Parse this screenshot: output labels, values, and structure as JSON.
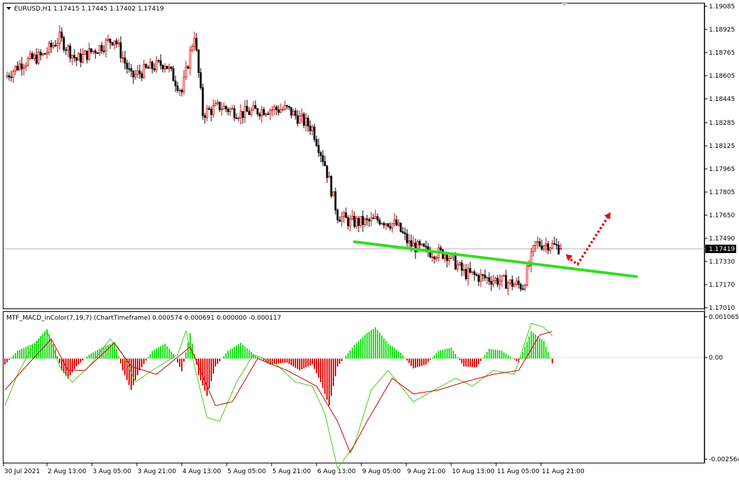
{
  "price_panel": {
    "header": "EURUSD,H1  1.17415 1.17445 1.17402 1.17419",
    "ticks": [
      "1.19085",
      "1.18925",
      "1.18765",
      "1.18605",
      "1.18445",
      "1.18285",
      "1.18125",
      "1.17965",
      "1.17805",
      "1.17650",
      "1.17490",
      "1.17330",
      "1.17170",
      "1.17010"
    ],
    "current_price_label": "1.17419"
  },
  "macd_panel": {
    "header": "MTF_MACD_inColor(7,19,7) (ChartTimeframe) 0.000574 0.000691 0.000000 -0.000117",
    "ticks": [
      "0.001065",
      "0.00",
      "-0.002564"
    ]
  },
  "time_axis": {
    "labels": [
      "30 Jul 2021",
      "2 Aug 13:00",
      "3 Aug 05:00",
      "3 Aug 21:00",
      "4 Aug 13:00",
      "5 Aug 05:00",
      "5 Aug 21:00",
      "6 Aug 13:00",
      "9 Aug 05:00",
      "9 Aug 21:00",
      "10 Aug 13:00",
      "11 Aug 05:00",
      "11 Aug 21:00"
    ]
  },
  "colors": {
    "bull_candle": "#d00000",
    "bear_candle": "#000000",
    "trendline": "#33dd22",
    "projection_arrow": "#e01010",
    "hist_positive": "#22dd22",
    "hist_negative": "#e01010",
    "macd_line": "#44cc11",
    "signal_line": "#cc0000",
    "grid_price_line": "#aaaaaa"
  },
  "chart_data": [
    {
      "type": "candlestick",
      "symbol": "EURUSD",
      "timeframe": "H1",
      "ylim": [
        1.1701,
        1.1909
      ],
      "last": {
        "open": 1.17415,
        "high": 1.17445,
        "low": 1.17402,
        "close": 1.17419
      },
      "path_close_by_bar": [
        [
          0,
          1.186
        ],
        [
          8,
          1.187
        ],
        [
          18,
          1.1875
        ],
        [
          26,
          1.1887
        ],
        [
          34,
          1.1872
        ],
        [
          44,
          1.188
        ],
        [
          52,
          1.1887
        ],
        [
          60,
          1.186
        ],
        [
          68,
          1.1866
        ],
        [
          76,
          1.187
        ],
        [
          84,
          1.185
        ],
        [
          90,
          1.189
        ],
        [
          94,
          1.1835
        ],
        [
          102,
          1.184
        ],
        [
          112,
          1.1835
        ],
        [
          124,
          1.1838
        ],
        [
          134,
          1.1838
        ],
        [
          146,
          1.1825
        ],
        [
          152,
          1.18
        ],
        [
          158,
          1.1765
        ],
        [
          164,
          1.176
        ],
        [
          172,
          1.176
        ],
        [
          178,
          1.1762
        ],
        [
          186,
          1.1758
        ],
        [
          192,
          1.1745
        ],
        [
          200,
          1.174
        ],
        [
          210,
          1.1738
        ],
        [
          218,
          1.1725
        ],
        [
          226,
          1.1722
        ],
        [
          234,
          1.172
        ],
        [
          240,
          1.1718
        ],
        [
          246,
          1.1716
        ],
        [
          252,
          1.1745
        ],
        [
          258,
          1.1745
        ],
        [
          264,
          1.17419
        ]
      ],
      "annotations": [
        {
          "type": "trendline",
          "from": {
            "bar": 166,
            "price": 1.17465
          },
          "to": {
            "bar": 300,
            "price": 1.17225
          }
        },
        {
          "type": "projection_arrow",
          "points": [
            {
              "bar": 267,
              "price": 1.1736
            },
            {
              "bar": 272,
              "price": 1.1731
            },
            {
              "bar": 287,
              "price": 1.1765
            }
          ]
        }
      ]
    },
    {
      "type": "macd_histogram",
      "name": "MTF_MACD_inColor(7,19,7)",
      "ylim": [
        -0.002564,
        0.001065
      ],
      "values_at_last_bar": {
        "macd": 0.000574,
        "signal": 0.000691,
        "hist": -0.000117
      },
      "histogram_by_bar": [
        [
          0,
          -0.00015
        ],
        [
          6,
          0.0002
        ],
        [
          14,
          0.0004
        ],
        [
          20,
          0.00075
        ],
        [
          24,
          0.00025
        ],
        [
          27,
          -0.0003
        ],
        [
          30,
          -0.0005
        ],
        [
          34,
          -0.0002
        ],
        [
          40,
          0.0001
        ],
        [
          46,
          0.00028
        ],
        [
          52,
          0.00042
        ],
        [
          56,
          -0.0003
        ],
        [
          60,
          -0.0008
        ],
        [
          64,
          -0.0003
        ],
        [
          70,
          0.0002
        ],
        [
          76,
          0.00038
        ],
        [
          80,
          0.00012
        ],
        [
          84,
          -0.00032
        ],
        [
          88,
          0.00065
        ],
        [
          92,
          -0.00042
        ],
        [
          96,
          -0.00095
        ],
        [
          100,
          -0.0002
        ],
        [
          106,
          0.0002
        ],
        [
          112,
          0.0004
        ],
        [
          118,
          0.00012
        ],
        [
          126,
          -0.00015
        ],
        [
          134,
          -0.0001
        ],
        [
          140,
          -0.0003
        ],
        [
          146,
          -0.00015
        ],
        [
          150,
          -0.0006
        ],
        [
          154,
          -0.0012
        ],
        [
          158,
          -0.0002
        ],
        [
          166,
          0.00035
        ],
        [
          172,
          0.00065
        ],
        [
          176,
          0.0008
        ],
        [
          182,
          0.00038
        ],
        [
          188,
          0.00015
        ],
        [
          194,
          -0.00025
        ],
        [
          200,
          -0.00015
        ],
        [
          206,
          0.0002
        ],
        [
          212,
          0.00028
        ],
        [
          218,
          -0.0002
        ],
        [
          224,
          -0.00022
        ],
        [
          230,
          0.00025
        ],
        [
          236,
          0.0002
        ],
        [
          244,
          -0.0001
        ],
        [
          250,
          0.0007
        ],
        [
          256,
          0.00045
        ],
        [
          260,
          -0.000117
        ]
      ],
      "macd_by_bar": [
        [
          0,
          -0.0012
        ],
        [
          6,
          -0.0004
        ],
        [
          12,
          0.0002
        ],
        [
          20,
          0.0007
        ],
        [
          26,
          -0.0002
        ],
        [
          32,
          -0.0006
        ],
        [
          40,
          -0.0002
        ],
        [
          50,
          0.0005
        ],
        [
          56,
          0.0001
        ],
        [
          62,
          -0.0006
        ],
        [
          70,
          -0.0003
        ],
        [
          82,
          0.0001
        ],
        [
          86,
          0.0007
        ],
        [
          96,
          -0.0015
        ],
        [
          102,
          -0.0016
        ],
        [
          110,
          -0.0006
        ],
        [
          118,
          0.0001
        ],
        [
          128,
          -0.0001
        ],
        [
          138,
          -0.0006
        ],
        [
          146,
          -0.0007
        ],
        [
          152,
          -0.0014
        ],
        [
          158,
          -0.0028
        ],
        [
          166,
          -0.0022
        ],
        [
          174,
          -0.0008
        ],
        [
          182,
          -0.0003
        ],
        [
          194,
          -0.0011
        ],
        [
          204,
          -0.0008
        ],
        [
          214,
          -0.0005
        ],
        [
          222,
          -0.0007
        ],
        [
          232,
          -0.0003
        ],
        [
          242,
          -0.0004
        ],
        [
          250,
          0.0009
        ],
        [
          256,
          0.0008
        ],
        [
          260,
          0.000574
        ]
      ],
      "signal_by_bar": [
        [
          0,
          -0.0008
        ],
        [
          10,
          -0.0002
        ],
        [
          22,
          0.0005
        ],
        [
          30,
          -0.0003
        ],
        [
          38,
          -0.0003
        ],
        [
          52,
          0.0004
        ],
        [
          60,
          -0.0002
        ],
        [
          72,
          -0.0004
        ],
        [
          88,
          0.0003
        ],
        [
          100,
          -0.0012
        ],
        [
          108,
          -0.0011
        ],
        [
          120,
          0.0
        ],
        [
          134,
          -0.0003
        ],
        [
          148,
          -0.0007
        ],
        [
          158,
          -0.0016
        ],
        [
          164,
          -0.0024
        ],
        [
          172,
          -0.0016
        ],
        [
          184,
          -0.0005
        ],
        [
          194,
          -0.0009
        ],
        [
          206,
          -0.0008
        ],
        [
          218,
          -0.0006
        ],
        [
          232,
          -0.0004
        ],
        [
          244,
          -0.0003
        ],
        [
          254,
          0.0006
        ],
        [
          260,
          0.000691
        ]
      ]
    }
  ]
}
